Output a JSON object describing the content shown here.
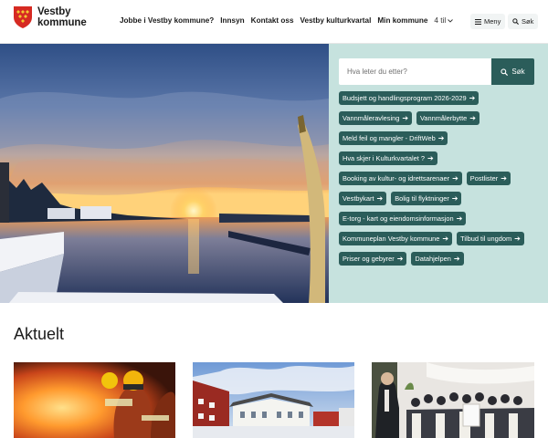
{
  "brand": {
    "name_line1": "Vestby",
    "name_line2": "kommune"
  },
  "nav": {
    "items": [
      "Jobbe i Vestby kommune?",
      "Innsyn",
      "Kontakt oss",
      "Vestby kulturkvartal",
      "Min kommune"
    ],
    "more_label": "4 til"
  },
  "header_buttons": {
    "menu_label": "Meny",
    "search_label": "Søk"
  },
  "search": {
    "placeholder": "Hva leter du etter?",
    "button_label": "Søk"
  },
  "quick_links": [
    "Budsjett og handlingsprogram 2026-2029",
    "Vannmåleravlesing",
    "Vannmålerbytte",
    "Meld feil og mangler - DriftWeb",
    "Hva skjer i Kulturkvartalet ?",
    "Booking av kultur- og idrettsarenaer",
    "Postlister",
    "Vestbykart",
    "Bolig til flyktninger",
    "E-torg - kart og eiendomsinformasjon",
    "Kommuneplan Vestby kommune",
    "Tilbud til ungdom",
    "Priser og gebyrer",
    "Datahjelpen"
  ],
  "section": {
    "title": "Aktuelt"
  },
  "icons": {
    "search": "search-icon",
    "menu": "menu-icon",
    "arrow": "arrow-right-icon",
    "chevron": "chevron-down-icon"
  },
  "colors": {
    "accent": "#2b5d5a",
    "panel": "#c6e2de"
  }
}
